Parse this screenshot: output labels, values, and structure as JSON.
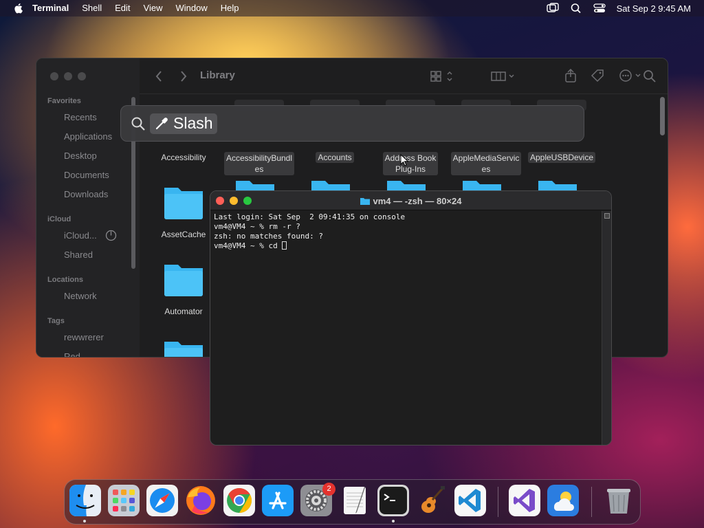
{
  "menubar": {
    "app_name": "Terminal",
    "items": [
      "Shell",
      "Edit",
      "View",
      "Window",
      "Help"
    ],
    "clock": "Sat Sep 2  9:45 AM"
  },
  "finder": {
    "title": "Library",
    "sidebar": {
      "favorites_header": "Favorites",
      "favorites": [
        "Recents",
        "Applications",
        "Desktop",
        "Documents",
        "Downloads"
      ],
      "icloud_header": "iCloud",
      "icloud": [
        "iCloud...",
        "Shared"
      ],
      "locations_header": "Locations",
      "locations": [
        "Network"
      ],
      "tags_header": "Tags",
      "tags": [
        "rewwrerer",
        "Red"
      ]
    },
    "folders_row1": [
      "Accessibility",
      "AccessibilityBundl\nes",
      "Accounts",
      "Address Book\nPlug-Ins",
      "AppleMediaServic\nes",
      "AppleUSBDevice"
    ],
    "folders_col1": [
      "AssetCache",
      "Automator"
    ]
  },
  "spotlight": {
    "token_label": "Slash"
  },
  "terminal": {
    "title": "vm4 — -zsh — 80×24",
    "lines": [
      "Last login: Sat Sep  2 09:41:35 on console",
      "vm4@VM4 ~ % rm -r ?",
      "zsh: no matches found: ?",
      "vm4@VM4 ~ % cd "
    ]
  },
  "dock": {
    "apps": [
      "Finder",
      "Launchpad",
      "Safari",
      "Firefox",
      "Chrome",
      "App Store",
      "System Settings",
      "TextEdit",
      "Terminal",
      "GarageBand",
      "Visual Studio Code",
      "Visual Studio",
      "Weather",
      "Trash"
    ],
    "settings_badge": "2"
  },
  "colors": {
    "close": "#ff5f57",
    "minimize": "#febc2e",
    "zoom": "#28c840",
    "folder_blue": "#39b5f0"
  }
}
